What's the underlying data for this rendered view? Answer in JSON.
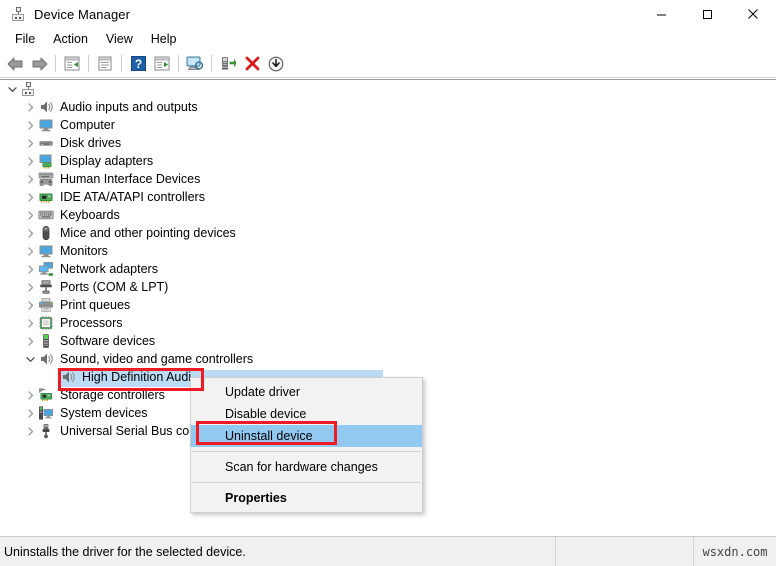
{
  "window": {
    "title": "Device Manager",
    "icon": "device-manager-icon",
    "minimize_label": "—",
    "maximize_label": "□",
    "close_label": "✕"
  },
  "menubar": {
    "items": [
      {
        "label": "File"
      },
      {
        "label": "Action"
      },
      {
        "label": "View"
      },
      {
        "label": "Help"
      }
    ]
  },
  "toolbar": {
    "items": [
      {
        "name": "back-icon"
      },
      {
        "name": "forward-icon"
      },
      {
        "name": "separator"
      },
      {
        "name": "show-hide-console-tree-icon"
      },
      {
        "name": "separator"
      },
      {
        "name": "properties-icon"
      },
      {
        "name": "separator"
      },
      {
        "name": "help-icon"
      },
      {
        "name": "show-hide-action-pane-icon"
      },
      {
        "name": "separator"
      },
      {
        "name": "scan-for-hardware-changes-icon"
      },
      {
        "name": "separator"
      },
      {
        "name": "update-driver-icon"
      },
      {
        "name": "uninstall-device-icon"
      },
      {
        "name": "disable-device-icon"
      }
    ]
  },
  "tree": {
    "root": {
      "label": "",
      "icon": "computer-root-icon",
      "expanded": true
    },
    "items": [
      {
        "label": "Audio inputs and outputs",
        "icon": "speaker-icon",
        "expanded": false
      },
      {
        "label": "Computer",
        "icon": "monitor-icon",
        "expanded": false
      },
      {
        "label": "Disk drives",
        "icon": "disk-icon",
        "expanded": false
      },
      {
        "label": "Display adapters",
        "icon": "display-adapter-icon",
        "expanded": false
      },
      {
        "label": "Human Interface Devices",
        "icon": "hid-icon",
        "expanded": false
      },
      {
        "label": "IDE ATA/ATAPI controllers",
        "icon": "ide-controller-icon",
        "expanded": false
      },
      {
        "label": "Keyboards",
        "icon": "keyboard-icon",
        "expanded": false
      },
      {
        "label": "Mice and other pointing devices",
        "icon": "mouse-icon",
        "expanded": false
      },
      {
        "label": "Monitors",
        "icon": "monitor-icon",
        "expanded": false
      },
      {
        "label": "Network adapters",
        "icon": "network-adapter-icon",
        "expanded": false
      },
      {
        "label": "Ports (COM & LPT)",
        "icon": "port-icon",
        "expanded": false
      },
      {
        "label": "Print queues",
        "icon": "printer-icon",
        "expanded": false
      },
      {
        "label": "Processors",
        "icon": "processor-icon",
        "expanded": false
      },
      {
        "label": "Software devices",
        "icon": "software-device-icon",
        "expanded": false
      },
      {
        "label": "Sound, video and game controllers",
        "icon": "speaker-icon",
        "expanded": true
      },
      {
        "label": "High Definition Audi",
        "icon": "speaker-icon",
        "child": true,
        "selected": true
      },
      {
        "label": "Storage controllers",
        "icon": "storage-controller-icon",
        "expanded": false
      },
      {
        "label": "System devices",
        "icon": "system-device-icon",
        "expanded": false
      },
      {
        "label": "Universal Serial Bus cont",
        "icon": "usb-icon",
        "expanded": false
      }
    ]
  },
  "context_menu": {
    "items": [
      {
        "label": "Update driver",
        "highlighted": false,
        "bold": false,
        "separator_after": false
      },
      {
        "label": "Disable device",
        "highlighted": false,
        "bold": false,
        "separator_after": false
      },
      {
        "label": "Uninstall device",
        "highlighted": true,
        "bold": false,
        "separator_after": true
      },
      {
        "label": "Scan for hardware changes",
        "highlighted": false,
        "bold": false,
        "separator_after": true
      },
      {
        "label": "Properties",
        "highlighted": false,
        "bold": true,
        "separator_after": false
      }
    ]
  },
  "status_bar": {
    "message": "Uninstalls the driver for the selected device.",
    "panel2": "",
    "watermark": "wsxdn.com"
  },
  "annotations": {
    "highlight_color": "#ee1b24",
    "selection_color": "#bcdcf5",
    "menu_highlight_color": "#91c9f0",
    "boxes": [
      {
        "name": "highlight-box-high-definition-audio"
      },
      {
        "name": "highlight-box-uninstall-device"
      }
    ]
  }
}
